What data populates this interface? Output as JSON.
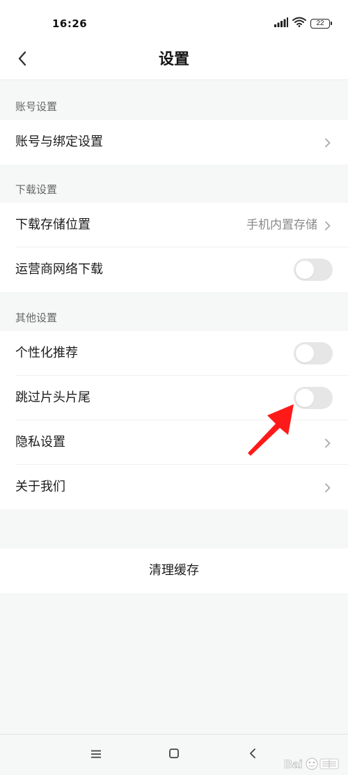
{
  "status_bar": {
    "time": "16:26",
    "battery": "22",
    "icons": [
      "signal-icon",
      "wifi-icon",
      "battery-icon"
    ]
  },
  "header": {
    "title": "设置",
    "back_icon": "chevron-left-icon"
  },
  "sections": [
    {
      "label": "账号设置",
      "rows": [
        {
          "label": "账号与绑定设置",
          "control": "chevron"
        }
      ]
    },
    {
      "label": "下载设置",
      "rows": [
        {
          "label": "下载存储位置",
          "value": "手机内置存储",
          "control": "chevron"
        },
        {
          "label": "运营商网络下载",
          "control": "toggle",
          "on": false
        }
      ]
    },
    {
      "label": "其他设置",
      "rows": [
        {
          "label": "个性化推荐",
          "control": "toggle",
          "on": false
        },
        {
          "label": "跳过片头片尾",
          "control": "toggle",
          "on": false
        },
        {
          "label": "隐私设置",
          "control": "chevron"
        },
        {
          "label": "关于我们",
          "control": "chevron"
        }
      ]
    }
  ],
  "clear_cache": {
    "label": "清理缓存"
  },
  "nav_bar": {
    "icons": [
      "menu-icon",
      "home-square-icon",
      "back-icon"
    ]
  },
  "annotation": {
    "color": "#ff1a1a"
  },
  "watermark": {
    "text": "Bai 经验"
  },
  "colors": {
    "toggle_off": "#e6e6e6",
    "secondary_text": "#8a8a8a",
    "background": "#f6f7f7"
  }
}
